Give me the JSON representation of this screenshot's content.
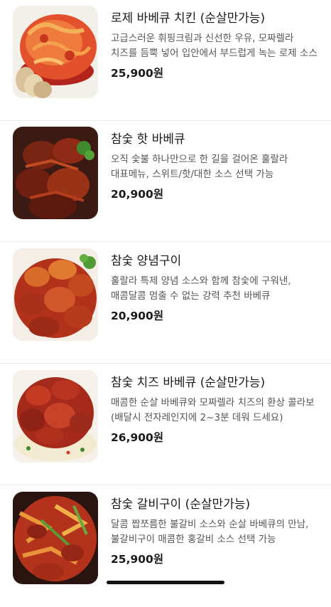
{
  "menu": {
    "items": [
      {
        "name": "로제 바베큐 치킨 (순살만가능)",
        "description": "고급스러운 휘핑크림과 신선한 우유, 모짜렐라 치즈를 듬뿍 넣어 입안에서 부드럽게 녹는 로제 소스",
        "price": "25,900원",
        "image": "rose-bbq-chicken-photo"
      },
      {
        "name": "참숯 핫 바베큐",
        "description": "오직 숯불 하나만으로 한 길을 걸어온 훌랄라 대표메뉴, 스위트/핫/대한 소스 선택 가능",
        "price": "20,900원",
        "image": "charcoal-hot-bbq-photo"
      },
      {
        "name": "참숯 양념구이",
        "description": "훌랄라 특제 양념 소스와 함께 참숯에 구워낸, 매콤달콤 멈출 수 없는 강력 추천 바베큐",
        "price": "20,900원",
        "image": "charcoal-seasoned-grill-photo"
      },
      {
        "name": "참숯 치즈 바베큐 (순살만가능)",
        "description": "매콤한 순살 바베큐와 모짜렐라 치즈의 환상 콜라보 (배달시 전자레인지에 2~3분 데워 드세요)",
        "price": "26,900원",
        "image": "charcoal-cheese-bbq-photo"
      },
      {
        "name": "참숯 갈비구이 (순살만가능)",
        "description": "달콤 짭쪼름한 불갈비 소스와 순살 바베큐의 만남, 불갈비구이 매콤한 홍갈비 소스 선택 가능",
        "price": "25,900원",
        "image": "charcoal-galbi-grill-photo"
      }
    ]
  }
}
